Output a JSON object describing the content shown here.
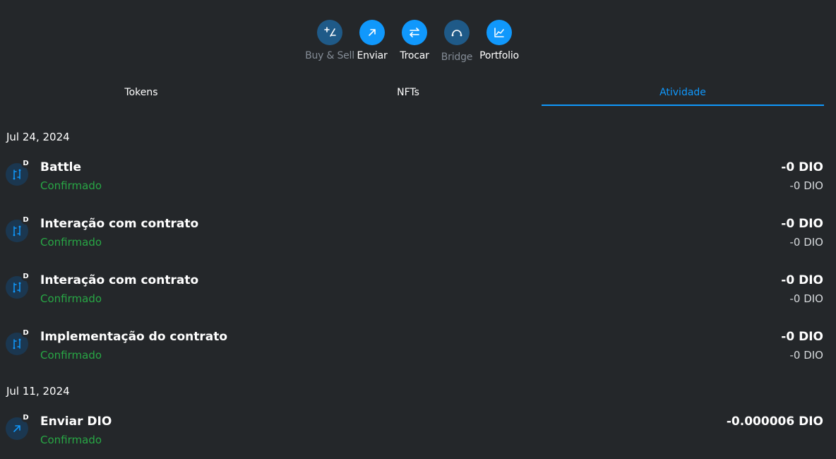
{
  "actions": [
    {
      "label": "Buy & Sell",
      "icon": "plus-minus-icon",
      "disabled": true
    },
    {
      "label": "Enviar",
      "icon": "arrow-up-right-icon",
      "disabled": false
    },
    {
      "label": "Trocar",
      "icon": "swap-arrows-icon",
      "disabled": false
    },
    {
      "label": "Bridge",
      "icon": "bridge-icon",
      "disabled": true
    },
    {
      "label": "Portfolio",
      "icon": "chart-line-icon",
      "disabled": false
    }
  ],
  "tabs": [
    {
      "label": "Tokens",
      "active": false
    },
    {
      "label": "NFTs",
      "active": false
    },
    {
      "label": "Atividade",
      "active": true
    }
  ],
  "activity": {
    "groups": [
      {
        "date": "Jul 24, 2024",
        "items": [
          {
            "title": "Battle",
            "status": "Confirmado",
            "amount": "-0 DIO",
            "fiat": "-0 DIO",
            "icon": "contract-interaction-icon",
            "badge": "D"
          },
          {
            "title": "Interação com contrato",
            "status": "Confirmado",
            "amount": "-0 DIO",
            "fiat": "-0 DIO",
            "icon": "contract-interaction-icon",
            "badge": "D"
          },
          {
            "title": "Interação com contrato",
            "status": "Confirmado",
            "amount": "-0 DIO",
            "fiat": "-0 DIO",
            "icon": "contract-interaction-icon",
            "badge": "D"
          },
          {
            "title": "Implementação do contrato",
            "status": "Confirmado",
            "amount": "-0 DIO",
            "fiat": "-0 DIO",
            "icon": "contract-interaction-icon",
            "badge": "D"
          }
        ]
      },
      {
        "date": "Jul 11, 2024",
        "items": [
          {
            "title": "Enviar DIO",
            "status": "Confirmado",
            "amount": "-0.000006 DIO",
            "fiat": "",
            "icon": "send-arrow-icon",
            "badge": "D"
          }
        ]
      }
    ]
  },
  "colors": {
    "background": "#24272a",
    "accent": "#1098fc",
    "success": "#28a745"
  }
}
